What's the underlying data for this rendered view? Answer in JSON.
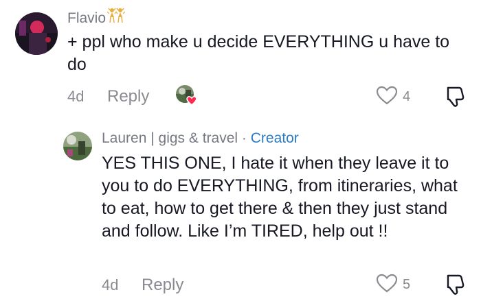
{
  "comments": [
    {
      "author": "Flavio",
      "author_badge_icon": "dancers-emoji-icon",
      "text": "+ ppl who make u decide EVERYTHING u have to do",
      "age": "4d",
      "reply_label": "Reply",
      "like_count": "4",
      "creator_liked": true
    },
    {
      "author": "Lauren | gigs & travel",
      "separator": " · ",
      "creator_label": "Creator",
      "text": "YES THIS ONE, I hate it when they leave it to you to do EVERYTHING, from itineraries, what to eat, how to get there & then they just stand and follow. Like I’m TIRED, help out !!",
      "age": "4d",
      "reply_label": "Reply",
      "like_count": "5"
    }
  ],
  "colors": {
    "text": "#161823",
    "muted": "#8a8b91",
    "creator": "#2b7bc4",
    "heart_badge": "#fe2c55"
  }
}
